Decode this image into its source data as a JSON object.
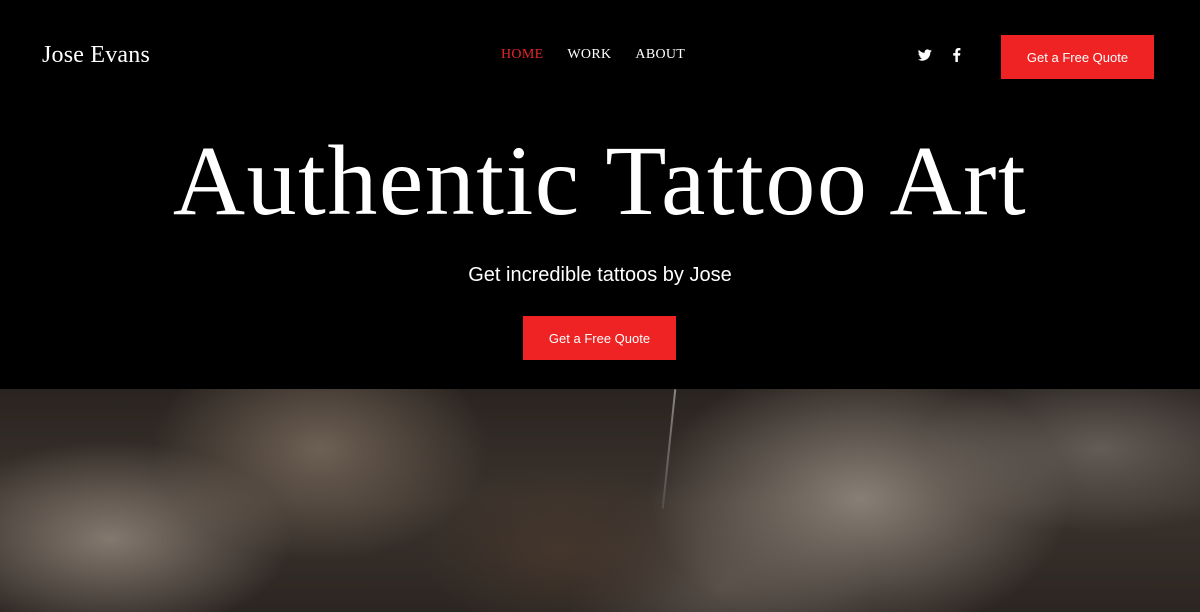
{
  "header": {
    "logo": "Jose Evans",
    "nav": [
      {
        "label": "HOME",
        "active": true
      },
      {
        "label": "WORK",
        "active": false
      },
      {
        "label": "ABOUT",
        "active": false
      }
    ],
    "social_icons": [
      "twitter-icon",
      "facebook-icon"
    ],
    "cta_label": "Get a Free Quote"
  },
  "hero": {
    "title": "Authentic Tattoo Art",
    "subtitle": "Get incredible tattoos by Jose",
    "cta_label": "Get a Free Quote"
  },
  "colors": {
    "background": "#000000",
    "accent": "#ef2323",
    "text": "#ffffff",
    "nav_active": "#e8252b"
  }
}
